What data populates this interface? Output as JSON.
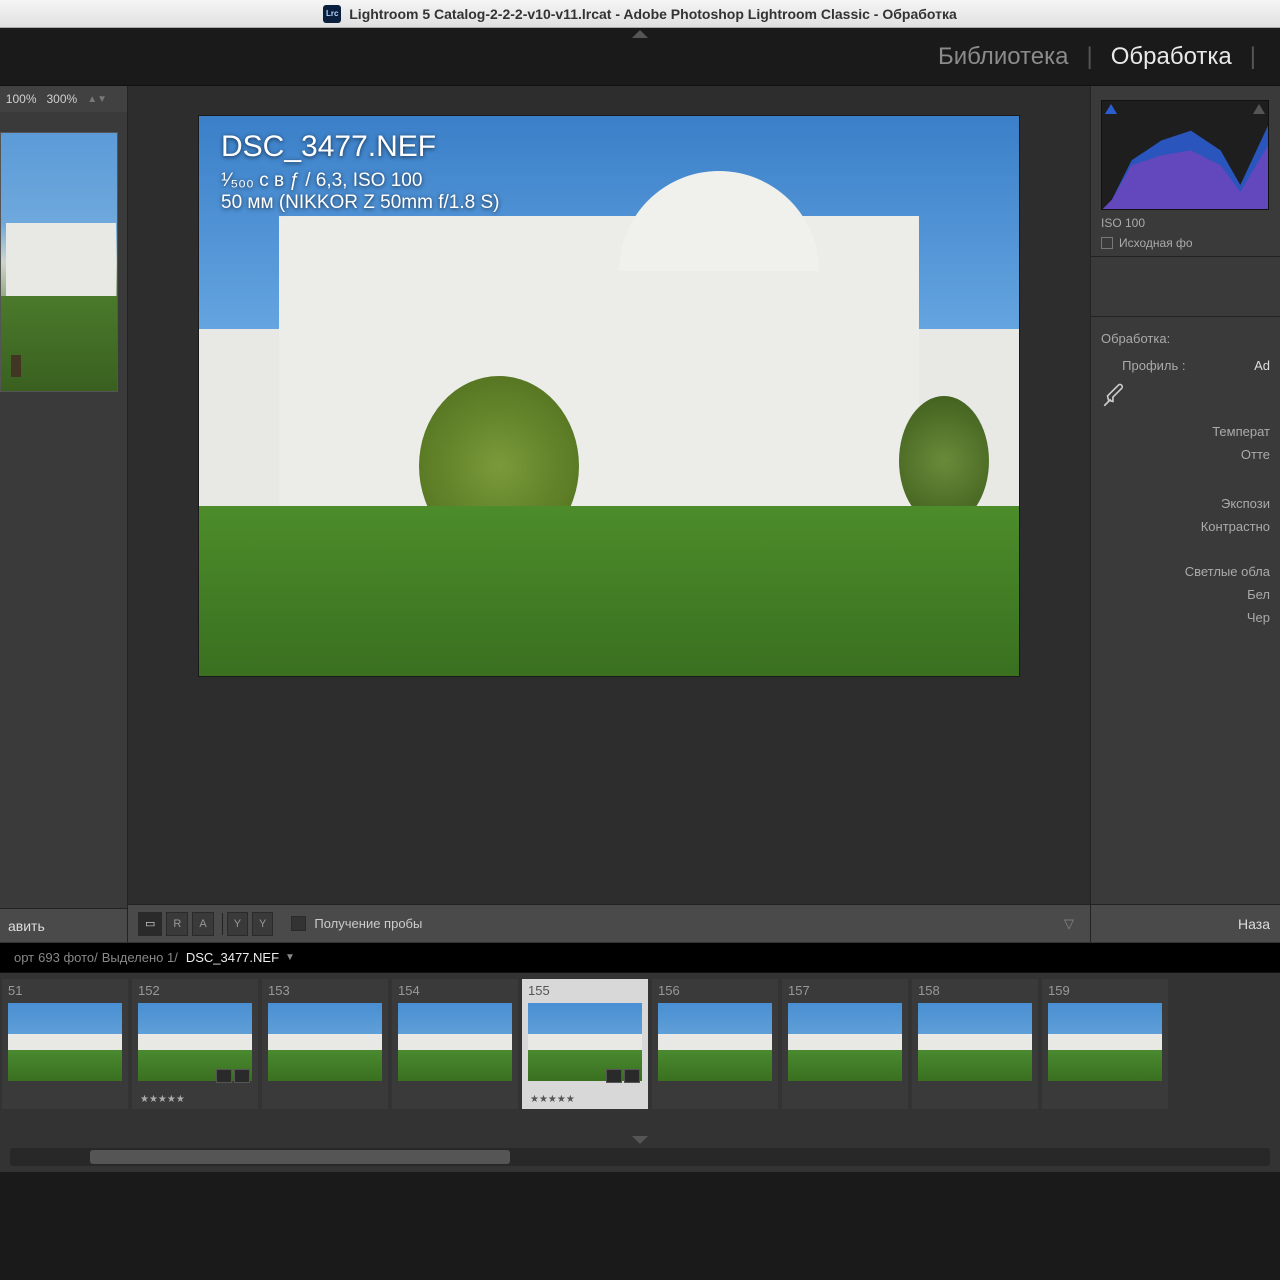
{
  "window": {
    "title": "Lightroom 5 Catalog-2-2-2-v10-v11.lrcat - Adobe Photoshop Lightroom Classic - Обработка",
    "app_icon_text": "Lrc"
  },
  "modules": {
    "library": "Библиотека",
    "develop": "Обработка"
  },
  "zoom": {
    "p100": "100%",
    "p300": "300%"
  },
  "left": {
    "bottom_button": "авить"
  },
  "photo_overlay": {
    "filename": "DSC_3477.NEF",
    "exposure": "¹⁄₅₀₀ с в ƒ / 6,3, ISO 100",
    "lens": "50 мм (NIKKOR Z 50mm f/1.8 S)"
  },
  "center_toolbar": {
    "btn_r": "R",
    "btn_a": "A",
    "btn_y1": "Y",
    "btn_y2": "Y",
    "soft_proof": "Получение пробы"
  },
  "right": {
    "iso_label": "ISO 100",
    "original_checkbox": "Исходная фо",
    "heading_develop": "Обработка:",
    "profile_label": "Профиль :",
    "profile_value": "Ad",
    "temp_label": "Температ",
    "tint_label": "Отте",
    "exposure_label": "Экспози",
    "contrast_label": "Контрастно",
    "highlights_label": "Светлые обла",
    "whites_label": "Бел",
    "blacks_label": "Чер",
    "bottom_button": "Наза"
  },
  "filmstrip_info": {
    "prefix": "орт",
    "count": "693 фото/",
    "selected": "Выделено 1/",
    "filename": "DSC_3477.NEF"
  },
  "thumbs": [
    {
      "num": "51"
    },
    {
      "num": "152"
    },
    {
      "num": "153"
    },
    {
      "num": "154"
    },
    {
      "num": "155"
    },
    {
      "num": "156"
    },
    {
      "num": "157"
    },
    {
      "num": "158"
    },
    {
      "num": "159"
    }
  ]
}
